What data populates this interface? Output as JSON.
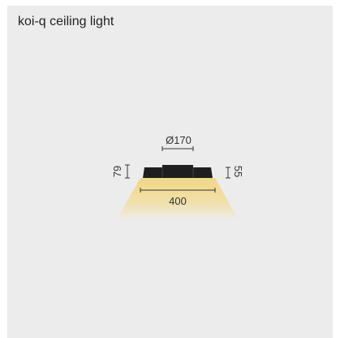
{
  "title": "koi-q ceiling light",
  "dimensions": {
    "top_diameter": "Ø170",
    "width": "400",
    "total_height": "79",
    "body_height": "55"
  },
  "colors": {
    "background": "#ececec",
    "fixture": "#1f1f1f",
    "light_beam": "#f3d77c",
    "text": "#333333"
  }
}
